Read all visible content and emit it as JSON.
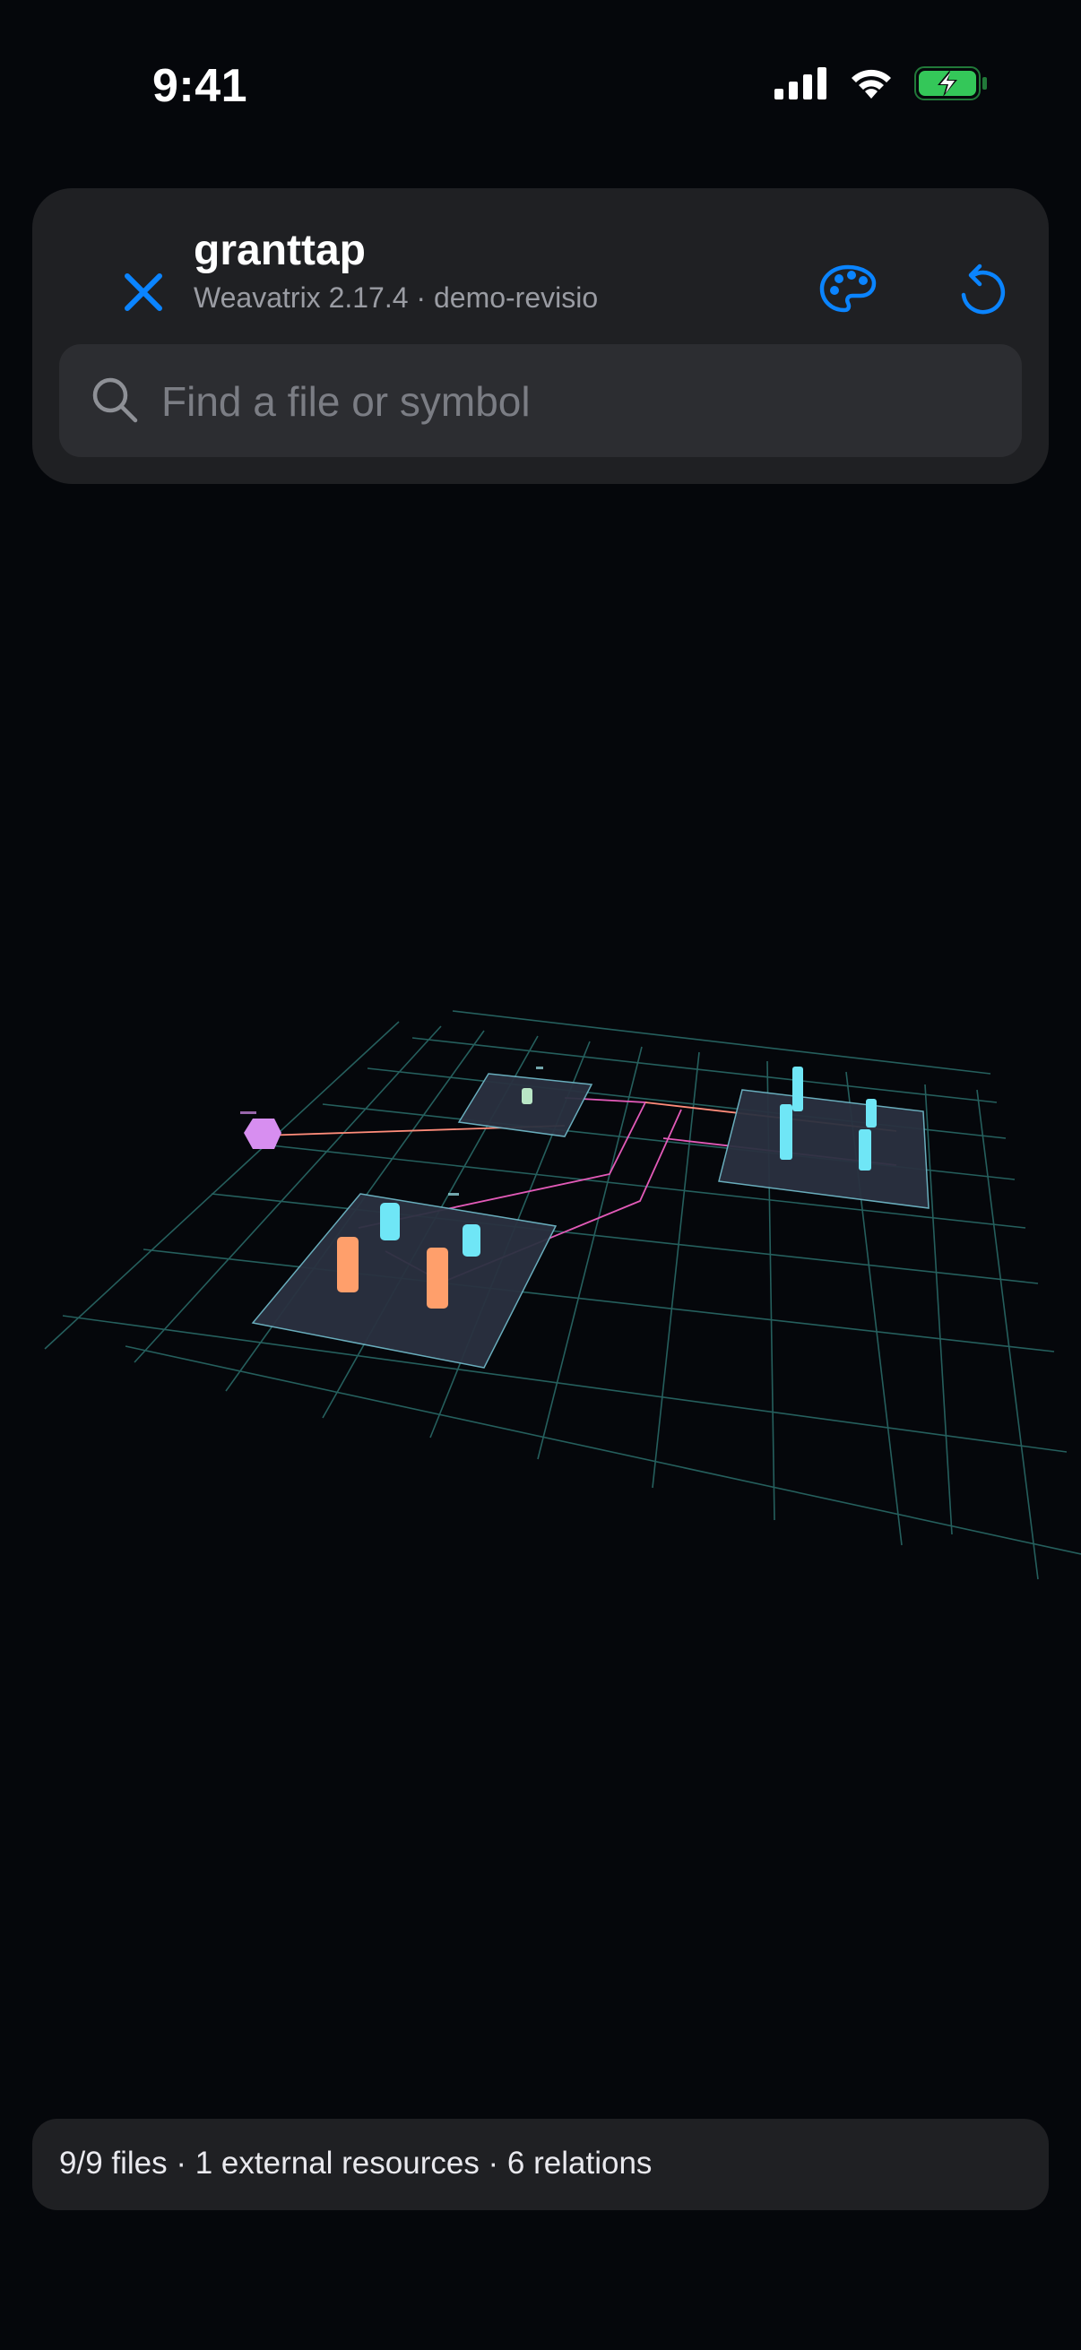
{
  "status_bar": {
    "time": "9:41",
    "icons": [
      "cellular-signal-icon",
      "wifi-icon",
      "battery-charging-icon"
    ]
  },
  "header": {
    "title": "granttap",
    "subtitle": "Weavatrix 2.17.4 · demo-revisio",
    "close_icon": "close-icon",
    "palette_icon": "palette-icon",
    "reset_icon": "rotate-ccw-icon",
    "accent_color": "#0a84ff"
  },
  "search": {
    "placeholder": "Find a file or symbol",
    "value": ""
  },
  "footer": {
    "summary": "9/9 files · 1 external resources · 6 relations"
  },
  "scene": {
    "colors": {
      "grid": "#2b6f6c",
      "platform": "#2a3140",
      "platform_edge": "#6fb6c6",
      "file_cyan": "#6fe6f6",
      "file_orange": "#ff9f6b",
      "file_mint": "#b9e6c6",
      "external": "#d78ef0",
      "relation": "#e25ab8",
      "relation_orange": "#ff8c7a"
    }
  }
}
